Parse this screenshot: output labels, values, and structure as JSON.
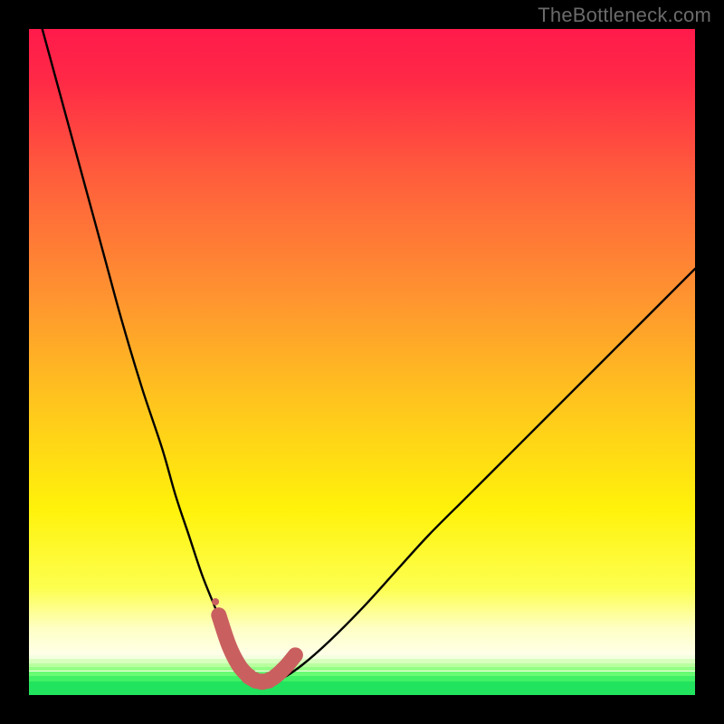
{
  "watermark": "TheBottleneck.com",
  "colors": {
    "frame": "#000000",
    "curve": "#000000",
    "marker_stroke": "#c9605f",
    "marker_fill": "#c9605f",
    "gradient_stops": [
      {
        "pct": 0,
        "color": "#ff1a4b"
      },
      {
        "pct": 8,
        "color": "#ff2a46"
      },
      {
        "pct": 22,
        "color": "#ff5d3c"
      },
      {
        "pct": 40,
        "color": "#ff9330"
      },
      {
        "pct": 55,
        "color": "#ffc21f"
      },
      {
        "pct": 72,
        "color": "#fff20a"
      },
      {
        "pct": 84,
        "color": "#fdff50"
      },
      {
        "pct": 90,
        "color": "#feffc4"
      },
      {
        "pct": 94,
        "color": "#ffffe9"
      }
    ],
    "green_bands": [
      {
        "top_pct": 94.0,
        "height_pct": 0.6,
        "color": "#f4ffe0"
      },
      {
        "top_pct": 94.6,
        "height_pct": 0.6,
        "color": "#d9ffbf"
      },
      {
        "top_pct": 95.2,
        "height_pct": 0.6,
        "color": "#b9ff9f"
      },
      {
        "top_pct": 95.8,
        "height_pct": 0.6,
        "color": "#94ff86"
      },
      {
        "top_pct": 96.4,
        "height_pct": 0.7,
        "color": "#69fb74"
      },
      {
        "top_pct": 97.1,
        "height_pct": 0.9,
        "color": "#40f165"
      },
      {
        "top_pct": 98.0,
        "height_pct": 2.0,
        "color": "#22e35d"
      }
    ]
  },
  "chart_data": {
    "type": "line",
    "title": "",
    "xlabel": "",
    "ylabel": "",
    "xlim": [
      0,
      100
    ],
    "ylim": [
      0,
      100
    ],
    "series": [
      {
        "name": "bottleneck-curve",
        "x": [
          2,
          5,
          8,
          11,
          14,
          17,
          20,
          22,
          24,
          26,
          28,
          29.5,
          31,
          32.5,
          34,
          36,
          38,
          41,
          45,
          50,
          55,
          60,
          66,
          72,
          78,
          85,
          92,
          100
        ],
        "y": [
          100,
          89,
          78,
          67,
          56,
          46,
          37,
          30,
          24,
          18,
          13,
          9,
          6,
          3.5,
          2.2,
          2.0,
          2.5,
          4.5,
          8,
          13,
          18.5,
          24,
          30,
          36,
          42,
          49,
          56,
          64
        ]
      }
    ],
    "markers": {
      "name": "highlight-band",
      "x": [
        28.5,
        30,
        31.5,
        33,
        34,
        35,
        36,
        37,
        38.5,
        40
      ],
      "y": [
        12,
        7.5,
        4.5,
        2.8,
        2.2,
        2.0,
        2.2,
        2.8,
        4.2,
        6
      ],
      "r": [
        5,
        8,
        8.5,
        9,
        9,
        9,
        9,
        8.5,
        8,
        6
      ]
    },
    "extra_dot": {
      "x": 28.0,
      "y": 14.0,
      "r": 4
    }
  }
}
